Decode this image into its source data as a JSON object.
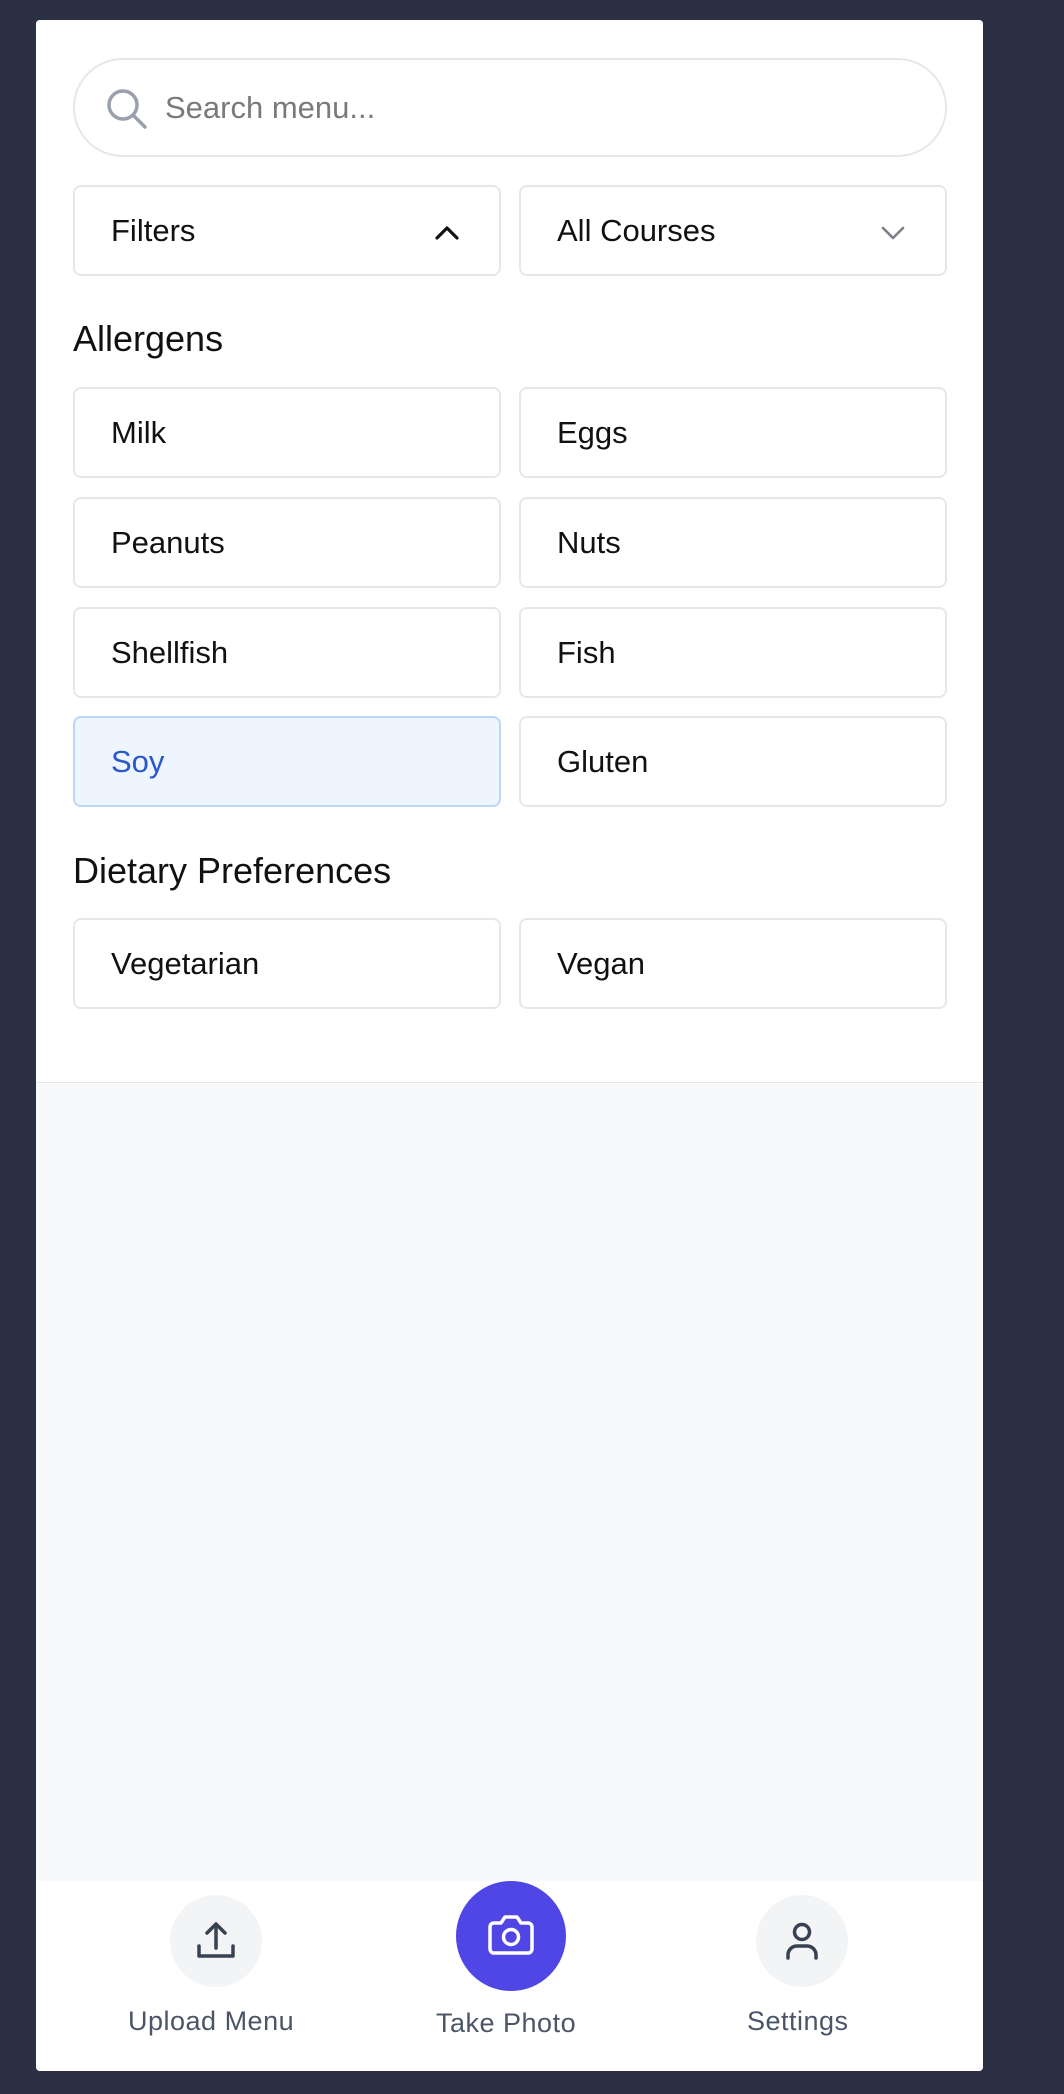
{
  "search": {
    "placeholder": "Search menu..."
  },
  "filters": {
    "label": "Filters",
    "icon": "chevron-up-icon"
  },
  "courses": {
    "selected": "All Courses",
    "icon": "chevron-down-icon"
  },
  "allergens": {
    "title": "Allergens",
    "items": [
      {
        "label": "Milk",
        "selected": false
      },
      {
        "label": "Eggs",
        "selected": false
      },
      {
        "label": "Peanuts",
        "selected": false
      },
      {
        "label": "Nuts",
        "selected": false
      },
      {
        "label": "Shellfish",
        "selected": false
      },
      {
        "label": "Fish",
        "selected": false
      },
      {
        "label": "Soy",
        "selected": true
      },
      {
        "label": "Gluten",
        "selected": false
      }
    ]
  },
  "dietary": {
    "title": "Dietary Preferences",
    "items": [
      {
        "label": "Vegetarian",
        "selected": false
      },
      {
        "label": "Vegan",
        "selected": false
      }
    ]
  },
  "nav": {
    "upload": {
      "label": "Upload Menu",
      "icon": "upload-icon"
    },
    "photo": {
      "label": "Take Photo",
      "icon": "camera-icon"
    },
    "settings": {
      "label": "Settings",
      "icon": "user-icon"
    }
  },
  "colors": {
    "background": "#2c3045",
    "accent": "#4f46e5",
    "selected_bg": "#eef5ff",
    "selected_text": "#2b56c8"
  }
}
